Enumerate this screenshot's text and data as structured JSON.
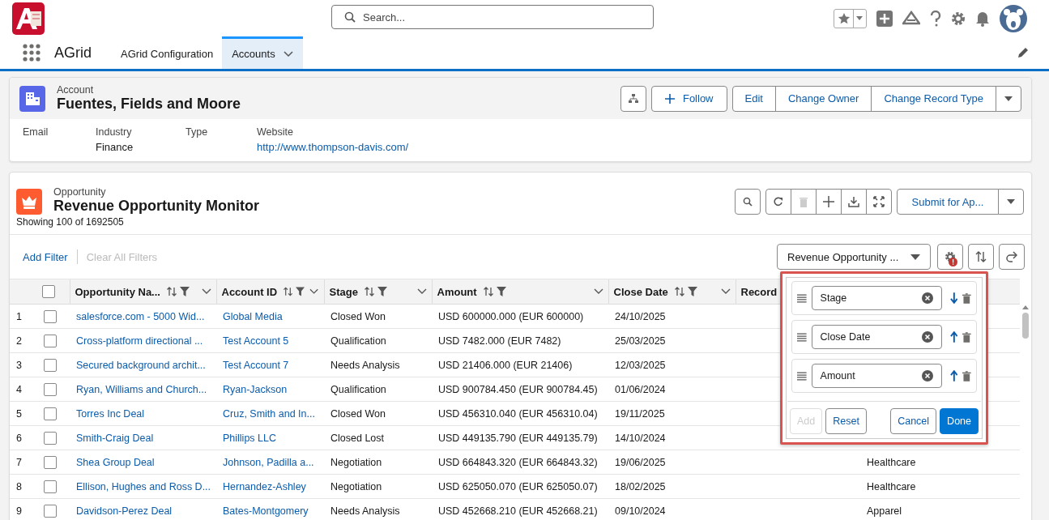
{
  "app": {
    "name": "AGrid"
  },
  "search": {
    "placeholder": "Search..."
  },
  "nav_tabs": [
    {
      "label": "AGrid Configuration",
      "selected": false
    },
    {
      "label": "Accounts",
      "selected": true
    }
  ],
  "account": {
    "object": "Account",
    "name": "Fuentes, Fields and Moore",
    "actions": [
      "Edit",
      "Change Owner",
      "Change Record Type"
    ],
    "follow": "Follow",
    "fields": [
      {
        "label": "Email"
      },
      {
        "label": "Industry",
        "value": "Finance",
        "kind": "text"
      },
      {
        "label": "Type"
      },
      {
        "label": "Website",
        "value": "http://www.thompson-davis.com/",
        "kind": "link"
      }
    ]
  },
  "grid": {
    "object": "Opportunity",
    "title": "Revenue Opportunity Monitor",
    "count": "Showing 100 of 1692505",
    "action": "Submit for Ap...",
    "filters": [
      {
        "label": "Add Filter",
        "disabled": false
      },
      {
        "label": "Clear All Filters",
        "disabled": true
      }
    ],
    "view": "Revenue Opportunity ...",
    "settings_alert": true,
    "all_checked": false,
    "columns": [
      {
        "label": "Opportunity Na..."
      },
      {
        "label": "Account ID"
      },
      {
        "label": "Stage"
      },
      {
        "label": "Amount"
      },
      {
        "label": "Close Date"
      },
      {
        "label": "Record"
      }
    ],
    "rows": [
      {
        "number": "1",
        "checked": false,
        "opportunity": "salesforce.com - 5000 Wid...",
        "account": "Global Media",
        "stage": "Closed Won",
        "amount": "USD 600000.000 (EUR 600000)",
        "close_date": "24/10/2025"
      },
      {
        "number": "2",
        "checked": false,
        "opportunity": "Cross-platform directional ...",
        "account": "Test Account 5",
        "stage": "Qualification",
        "amount": "USD 7482.000 (EUR 7482)",
        "close_date": "25/03/2025"
      },
      {
        "number": "3",
        "checked": false,
        "opportunity": "Secured background archit...",
        "account": "Test Account 7",
        "stage": "Needs Analysis",
        "amount": "USD 21406.000 (EUR 21406)",
        "close_date": "12/03/2025"
      },
      {
        "number": "4",
        "checked": false,
        "opportunity": "Ryan, Williams and Church...",
        "account": "Ryan-Jackson",
        "stage": "Qualification",
        "amount": "USD 900784.450 (EUR 900784.45)",
        "close_date": "01/06/2024"
      },
      {
        "number": "5",
        "checked": false,
        "opportunity": "Torres Inc Deal",
        "account": "Cruz, Smith and In...",
        "stage": "Closed Won",
        "amount": "USD 456310.040 (EUR 456310.04)",
        "close_date": "19/11/2025"
      },
      {
        "number": "6",
        "checked": false,
        "opportunity": "Smith-Craig Deal",
        "account": "Phillips LLC",
        "stage": "Closed Lost",
        "amount": "USD 449135.790 (EUR 449135.79)",
        "close_date": "14/10/2024"
      },
      {
        "number": "7",
        "checked": false,
        "opportunity": "Shea Group Deal",
        "account": "Johnson, Padilla a...",
        "stage": "Negotiation",
        "amount": "USD 664843.320 (EUR 664843.32)",
        "close_date": "19/06/2025",
        "industry": "Healthcare"
      },
      {
        "number": "8",
        "checked": false,
        "opportunity": "Ellison, Hughes and Ross D...",
        "account": "Hernandez-Ashley",
        "stage": "Negotiation",
        "amount": "USD 625050.070 (EUR 625050.07)",
        "close_date": "18/02/2025",
        "industry": "Healthcare"
      },
      {
        "number": "9",
        "checked": false,
        "opportunity": "Davidson-Perez Deal",
        "account": "Bates-Montgomery",
        "stage": "Needs Analysis",
        "amount": "USD 452668.210 (EUR 452668.21)",
        "close_date": "09/10/2024",
        "industry": "Apparel"
      }
    ]
  },
  "sort_popup": {
    "items": [
      {
        "field": "Stage",
        "descending": true
      },
      {
        "field": "Close Date",
        "descending": false
      },
      {
        "field": "Amount",
        "descending": false
      }
    ],
    "buttons": [
      {
        "label": "Add",
        "kind": "disabled"
      },
      {
        "label": "Reset",
        "kind": "neutral"
      },
      {
        "label": "Cancel",
        "kind": "neutral"
      },
      {
        "label": "Done",
        "kind": "brand"
      }
    ]
  }
}
